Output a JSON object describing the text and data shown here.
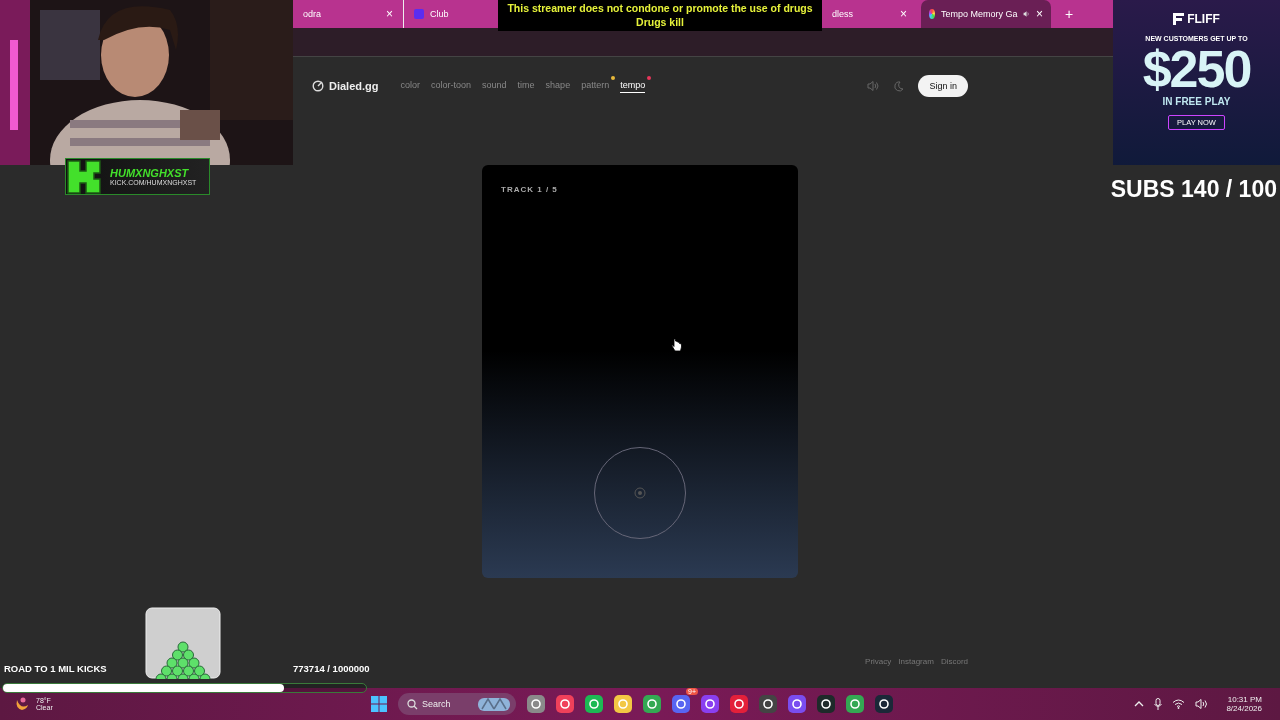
{
  "browser": {
    "tabs": [
      {
        "title": "odra",
        "selected": false,
        "close": "×",
        "audio": false
      },
      {
        "title": "Club",
        "selected": false,
        "audio": false
      },
      {
        "title": "dless",
        "selected": false,
        "close": "×",
        "audio": false
      },
      {
        "title": "Tempo Memory Ga",
        "selected": true,
        "close": "×",
        "audio": true
      }
    ],
    "new_tab": "+"
  },
  "site": {
    "logo": "Dialed.gg",
    "nav": [
      {
        "label": "color",
        "selected": false
      },
      {
        "label": "color-toon",
        "selected": false
      },
      {
        "label": "sound",
        "selected": false
      },
      {
        "label": "time",
        "selected": false
      },
      {
        "label": "shape",
        "selected": false
      },
      {
        "label": "pattern",
        "selected": false,
        "color": "#e8b93a"
      },
      {
        "label": "tempo",
        "selected": true,
        "color": "#e8365a"
      }
    ],
    "sign_in": "Sign in",
    "card": {
      "track": "TRACK 1 / 5"
    },
    "footer": [
      "Privacy",
      "Instagram",
      "Discord"
    ]
  },
  "overlay": {
    "disclaimer": [
      "This streamer does not condone or promote the use of drugs",
      "Drugs kill"
    ],
    "channel": {
      "name": "HUMXNGHXST",
      "url": "KICK.COM/HUMXNGHXST"
    },
    "ad": {
      "brand": "FLIFF",
      "headline": "NEW CUSTOMERS GET UP TO",
      "amount": "$250",
      "subline": "IN FREE PLAY",
      "cta": "PLAY NOW"
    },
    "subs": "SUBS 140 / 100",
    "goal": {
      "title": "ROAD TO 1 MIL KICKS",
      "reading": "773714 / 1000000",
      "level": 0.7737
    }
  },
  "taskbar": {
    "weather": {
      "temp": "78°F",
      "condition": "Clear"
    },
    "search": {
      "placeholder": "Search"
    },
    "chat_badge": "9+",
    "time": "10:31 PM",
    "date": "8/24/2026"
  }
}
